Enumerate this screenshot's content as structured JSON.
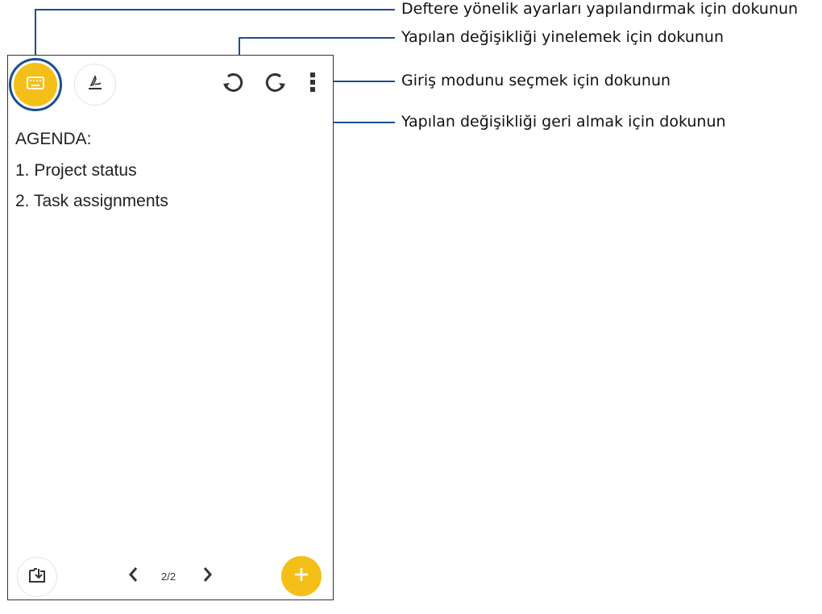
{
  "note": {
    "lines": [
      "AGENDA:",
      "1. Project status",
      "2. Task assignments"
    ]
  },
  "pager": {
    "page_indicator": "2/2"
  },
  "callouts": {
    "settings": "Deftere yönelik ayarları yapılandırmak için dokunun",
    "redo": "Yapılan değişikliği yinelemek için dokunun",
    "input_mode": "Giriş modunu seçmek için dokunun",
    "undo": "Yapılan değişikliği geri almak için dokunun"
  },
  "icons": {
    "toolbar": [
      "keyboard-icon",
      "pen-icon",
      "undo-icon",
      "redo-icon",
      "more-vert-icon"
    ],
    "bottom": [
      "import-icon",
      "chevron-left-icon",
      "chevron-right-icon",
      "plus-icon"
    ]
  },
  "colors": {
    "accent": "#f5bf1a",
    "callout_line": "#1a4f8e"
  }
}
